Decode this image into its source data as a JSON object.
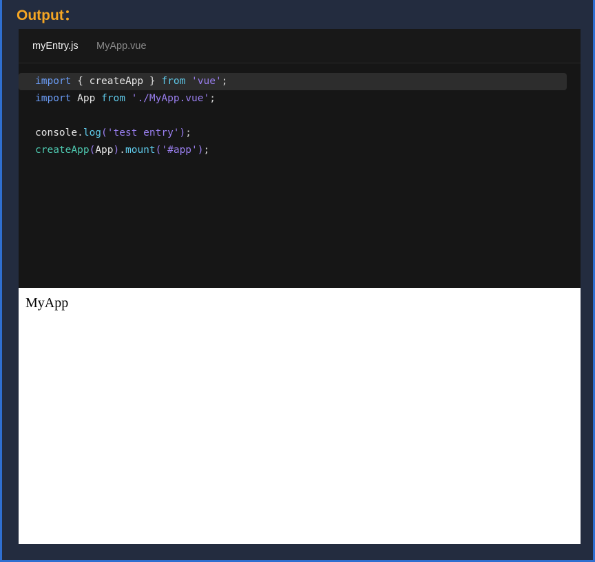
{
  "theme": {
    "page_background": "#242e42",
    "frame_border": "#2f6fd0",
    "title_color": "#f5a623",
    "code_panel_background": "#181818",
    "code_body_background": "#161616",
    "highlight_line_background": "#2d2d2d",
    "preview_background": "#ffffff",
    "tab_active_color": "#f2f2f2",
    "tab_inactive_color": "#8a8a8a"
  },
  "header": {
    "title": "Output："
  },
  "editor": {
    "tabs": [
      {
        "label": "myEntry.js",
        "active": true
      },
      {
        "label": "MyApp.vue",
        "active": false
      }
    ],
    "active_tab": "myEntry.js",
    "highlighted_line_number": 1,
    "lines": [
      {
        "number": 1,
        "highlighted": true,
        "text": "import { createApp } from 'vue';",
        "tokens": [
          {
            "text": "import",
            "type": "keyword"
          },
          {
            "text": " ",
            "type": "plain"
          },
          {
            "text": "{",
            "type": "brace"
          },
          {
            "text": " ",
            "type": "plain"
          },
          {
            "text": "createApp",
            "type": "plain"
          },
          {
            "text": " ",
            "type": "plain"
          },
          {
            "text": "}",
            "type": "brace"
          },
          {
            "text": " ",
            "type": "plain"
          },
          {
            "text": "from",
            "type": "from"
          },
          {
            "text": " ",
            "type": "plain"
          },
          {
            "text": "'vue'",
            "type": "string"
          },
          {
            "text": ";",
            "type": "semi"
          }
        ]
      },
      {
        "number": 2,
        "highlighted": false,
        "text": "import App from './MyApp.vue';",
        "tokens": [
          {
            "text": "import",
            "type": "keyword"
          },
          {
            "text": " ",
            "type": "plain"
          },
          {
            "text": "App",
            "type": "plain"
          },
          {
            "text": " ",
            "type": "plain"
          },
          {
            "text": "from",
            "type": "from"
          },
          {
            "text": " ",
            "type": "plain"
          },
          {
            "text": "'./MyApp.vue'",
            "type": "string"
          },
          {
            "text": ";",
            "type": "semi"
          }
        ]
      },
      {
        "number": 3,
        "highlighted": false,
        "text": "",
        "tokens": []
      },
      {
        "number": 4,
        "highlighted": false,
        "text": "console.log('test entry');",
        "tokens": [
          {
            "text": "console",
            "type": "plain"
          },
          {
            "text": ".",
            "type": "punct"
          },
          {
            "text": "log",
            "type": "method"
          },
          {
            "text": "(",
            "type": "paren"
          },
          {
            "text": "'test entry'",
            "type": "string"
          },
          {
            "text": ")",
            "type": "paren"
          },
          {
            "text": ";",
            "type": "semi"
          }
        ]
      },
      {
        "number": 5,
        "highlighted": false,
        "text": "createApp(App).mount('#app');",
        "tokens": [
          {
            "text": "createApp",
            "type": "func"
          },
          {
            "text": "(",
            "type": "paren"
          },
          {
            "text": "App",
            "type": "plain"
          },
          {
            "text": ")",
            "type": "paren"
          },
          {
            "text": ".",
            "type": "punct"
          },
          {
            "text": "mount",
            "type": "method"
          },
          {
            "text": "(",
            "type": "paren"
          },
          {
            "text": "'#app'",
            "type": "string"
          },
          {
            "text": ")",
            "type": "paren"
          },
          {
            "text": ";",
            "type": "semi"
          }
        ]
      }
    ]
  },
  "preview": {
    "app_text": "MyApp"
  }
}
